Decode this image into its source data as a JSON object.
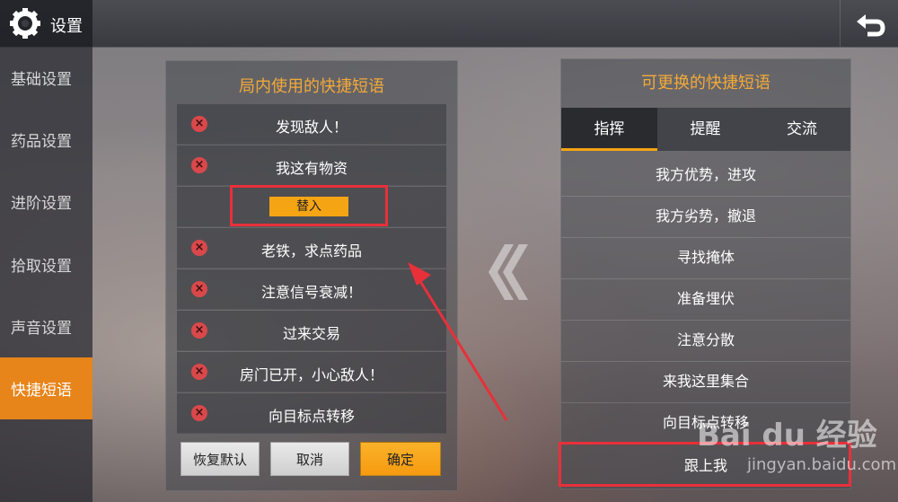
{
  "header": {
    "title": "设置",
    "settings_icon": "gear-icon",
    "back_icon": "back-arrow-icon"
  },
  "sidebar": {
    "items": [
      {
        "label": "基础设置"
      },
      {
        "label": "药品设置"
      },
      {
        "label": "进阶设置"
      },
      {
        "label": "拾取设置"
      },
      {
        "label": "声音设置"
      },
      {
        "label": "快捷短语",
        "active": true
      }
    ]
  },
  "left_panel": {
    "title": "局内使用的快捷短语",
    "rows": [
      "发现敌人！",
      "我这有物资",
      "",
      "老铁，求点药品",
      "注意信号衰减！",
      "过来交易",
      "房门已开，小心敌人！",
      "向目标点转移"
    ],
    "replace_label": "替入",
    "buttons": {
      "reset": "恢复默认",
      "cancel": "取消",
      "confirm": "确定"
    }
  },
  "right_panel": {
    "title": "可更换的快捷短语",
    "tabs": [
      {
        "label": "指挥",
        "active": true
      },
      {
        "label": "提醒"
      },
      {
        "label": "交流"
      }
    ],
    "items": [
      "我方优势，进攻",
      "我方劣势，撤退",
      "寻找掩体",
      "准备埋伏",
      "注意分散",
      "来我这里集合",
      "向目标点转移",
      "跟上我"
    ]
  },
  "watermark": {
    "text": "Bai du 经验",
    "sub": "jingyan.baidu.com"
  },
  "colors": {
    "accent": "#f5a414",
    "title_orange": "#f2a93b",
    "highlight_red": "#e8303a"
  }
}
